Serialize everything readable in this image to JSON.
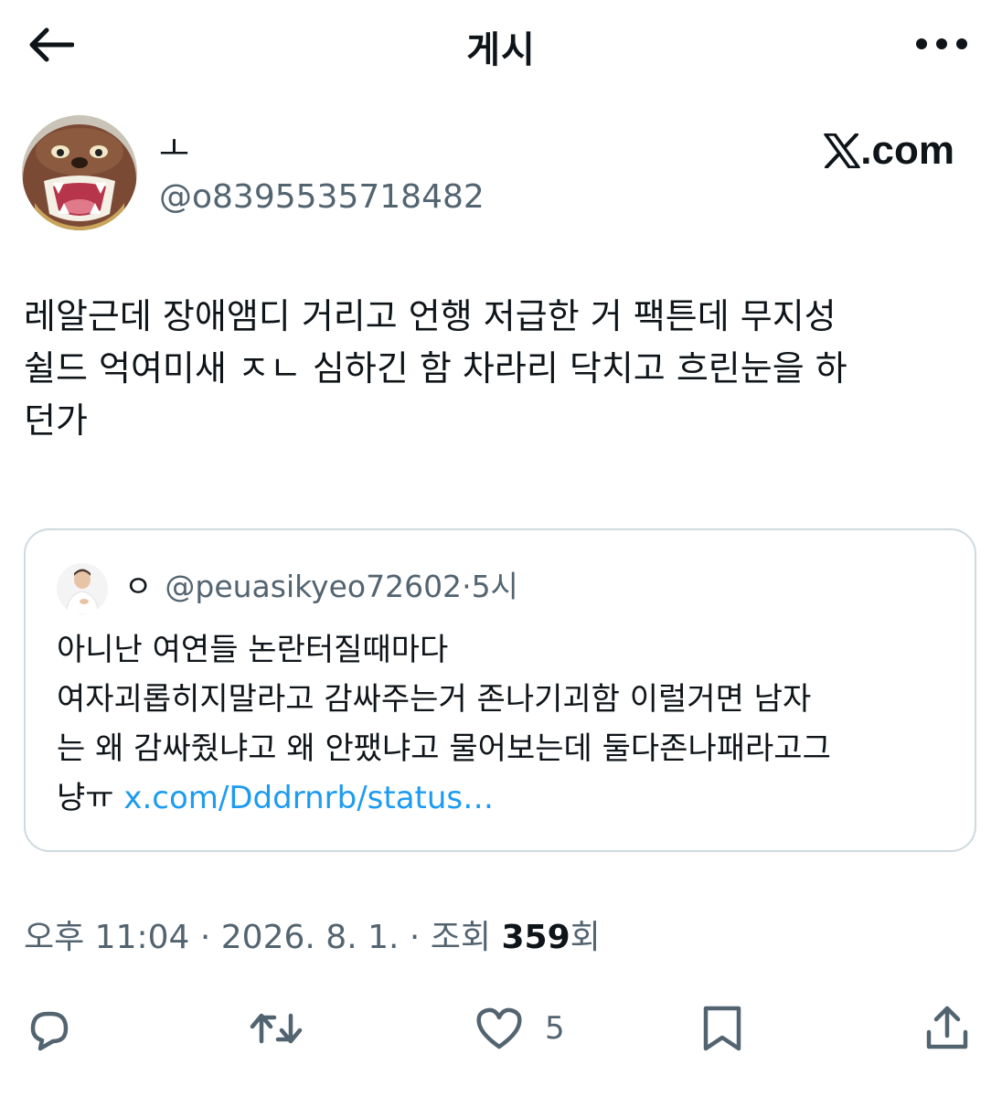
{
  "header": {
    "title": "게시"
  },
  "author": {
    "display_name": "ㅗ",
    "handle": "@o8395535718482"
  },
  "watermark": {
    "logo_icon": "x-logo-icon",
    "text": ".com"
  },
  "tweet": {
    "text": "레알근데 장애앰디 거리고 언행 저급한 거 팩튼데 무지성\n쉴드 억여미새 ㅈㄴ 심하긴 함 차라리 닥치고 흐린눈을 하\n던가"
  },
  "quoted": {
    "name": "ㅇ",
    "handle": "@peuasikyeo72602",
    "separator": "·",
    "time": "5시",
    "text": "아니난 여연들 논란터질때마다\n여자괴롭히지말라고 감싸주는거 존나기괴함 이럴거면 남자\n는 왜 감싸줬냐고 왜 안팼냐고 물어보는데 둘다존나패라고그\n냥ㅠ ",
    "link": "x.com/Dddrnrb/status…"
  },
  "meta": {
    "time": "오후 11:04",
    "sep1": " · ",
    "date": "2026. 8. 1.",
    "sep2": " · ",
    "views_label": "조회 ",
    "views_count": "359",
    "views_suffix": "회"
  },
  "actions": {
    "like_count": "5",
    "icons": [
      "reply-icon",
      "retweet-icon",
      "like-icon",
      "bookmark-icon",
      "share-icon"
    ]
  },
  "colors": {
    "text": "#0f1419",
    "secondary": "#536471",
    "link": "#1d9bf0",
    "border": "#cfd9de"
  }
}
